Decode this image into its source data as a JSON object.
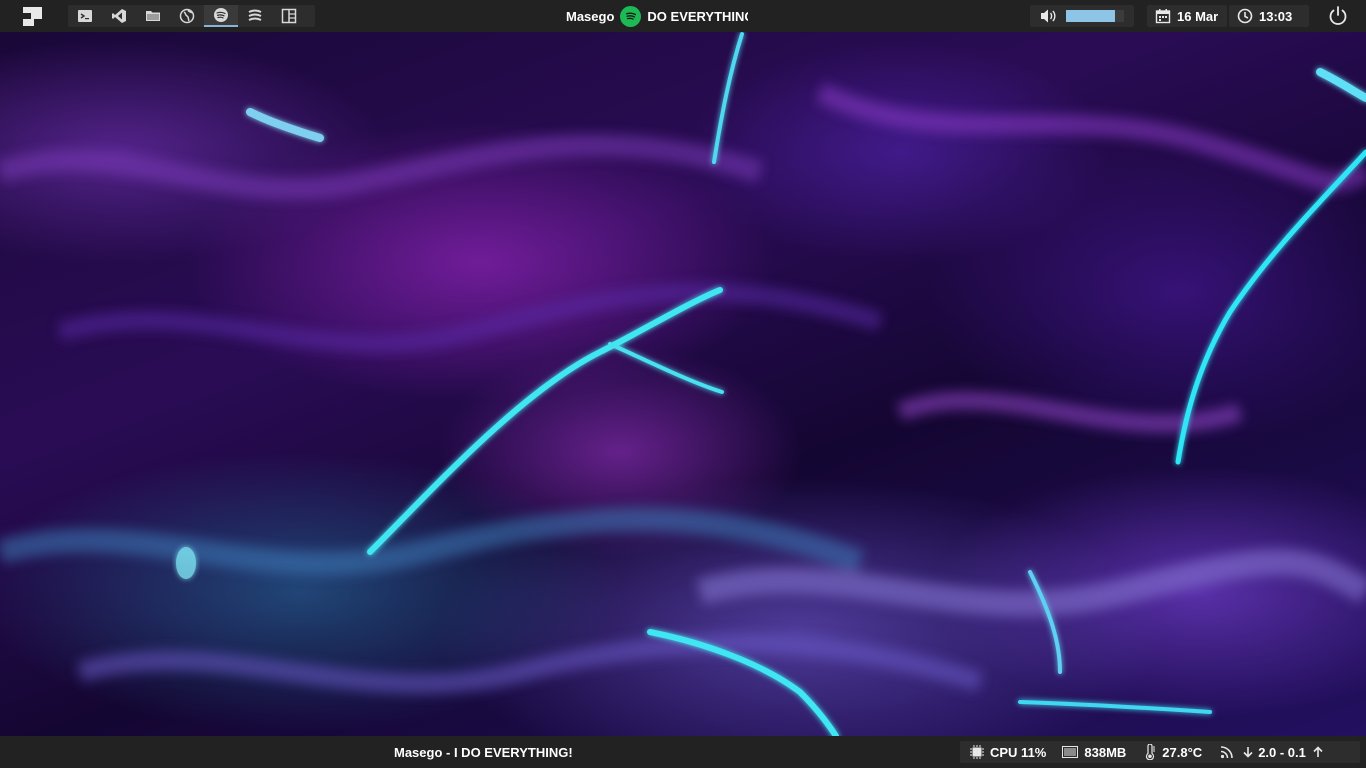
{
  "topbar": {
    "dock_items": [
      {
        "name": "terminal-icon",
        "active": false
      },
      {
        "name": "vscode-icon",
        "active": false
      },
      {
        "name": "folder-icon",
        "active": false
      },
      {
        "name": "globe-icon",
        "active": false
      },
      {
        "name": "spotify-icon",
        "active": true
      },
      {
        "name": "stack-icon",
        "active": false
      },
      {
        "name": "layout-icon",
        "active": false
      }
    ],
    "now_playing": {
      "artist": "Masego",
      "title": "DO EVERYTHING"
    },
    "volume": {
      "level_percent": 85
    },
    "date": "16 Mar",
    "time": "13:03"
  },
  "bottombar": {
    "track": "Masego - I DO EVERYTHING!",
    "cpu": "CPU 11%",
    "memory": "838MB",
    "temperature": "27.8°C",
    "network": "2.0 - 0.1"
  },
  "colors": {
    "bar_bg": "#222222",
    "module_bg": "#2d2d2d",
    "spotify_green": "#1db954",
    "volume_fill": "#8ec5e6"
  }
}
